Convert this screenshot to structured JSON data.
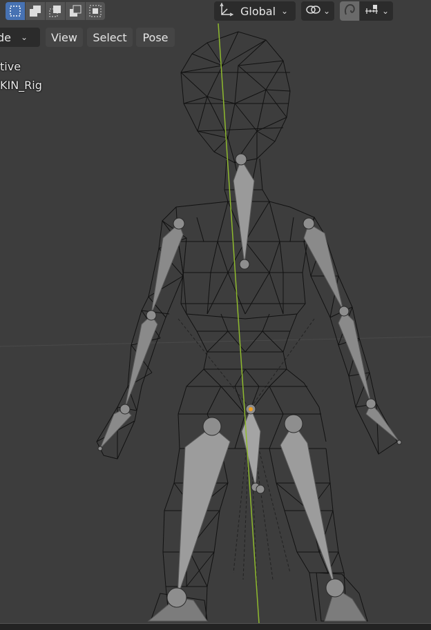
{
  "header": {
    "orientation_label": "Global",
    "mode_label": "de",
    "menus": [
      "View",
      "Select",
      "Pose"
    ]
  },
  "overlay": {
    "line1": "tive",
    "line2": "KIN_Rig"
  },
  "colors": {
    "active_accent": "#4772b3",
    "y_axis": "#8fba2e",
    "bone_fill": "#8a8a8a",
    "wire": "#000000",
    "background": "#3d3d3d"
  },
  "icons": [
    "box-select-icon",
    "set-selection-icon",
    "extend-selection-icon",
    "subtract-selection-icon",
    "intersect-selection-icon",
    "transform-orientation-icon",
    "pivot-link-icon",
    "snap-icon",
    "mirror-icon"
  ]
}
